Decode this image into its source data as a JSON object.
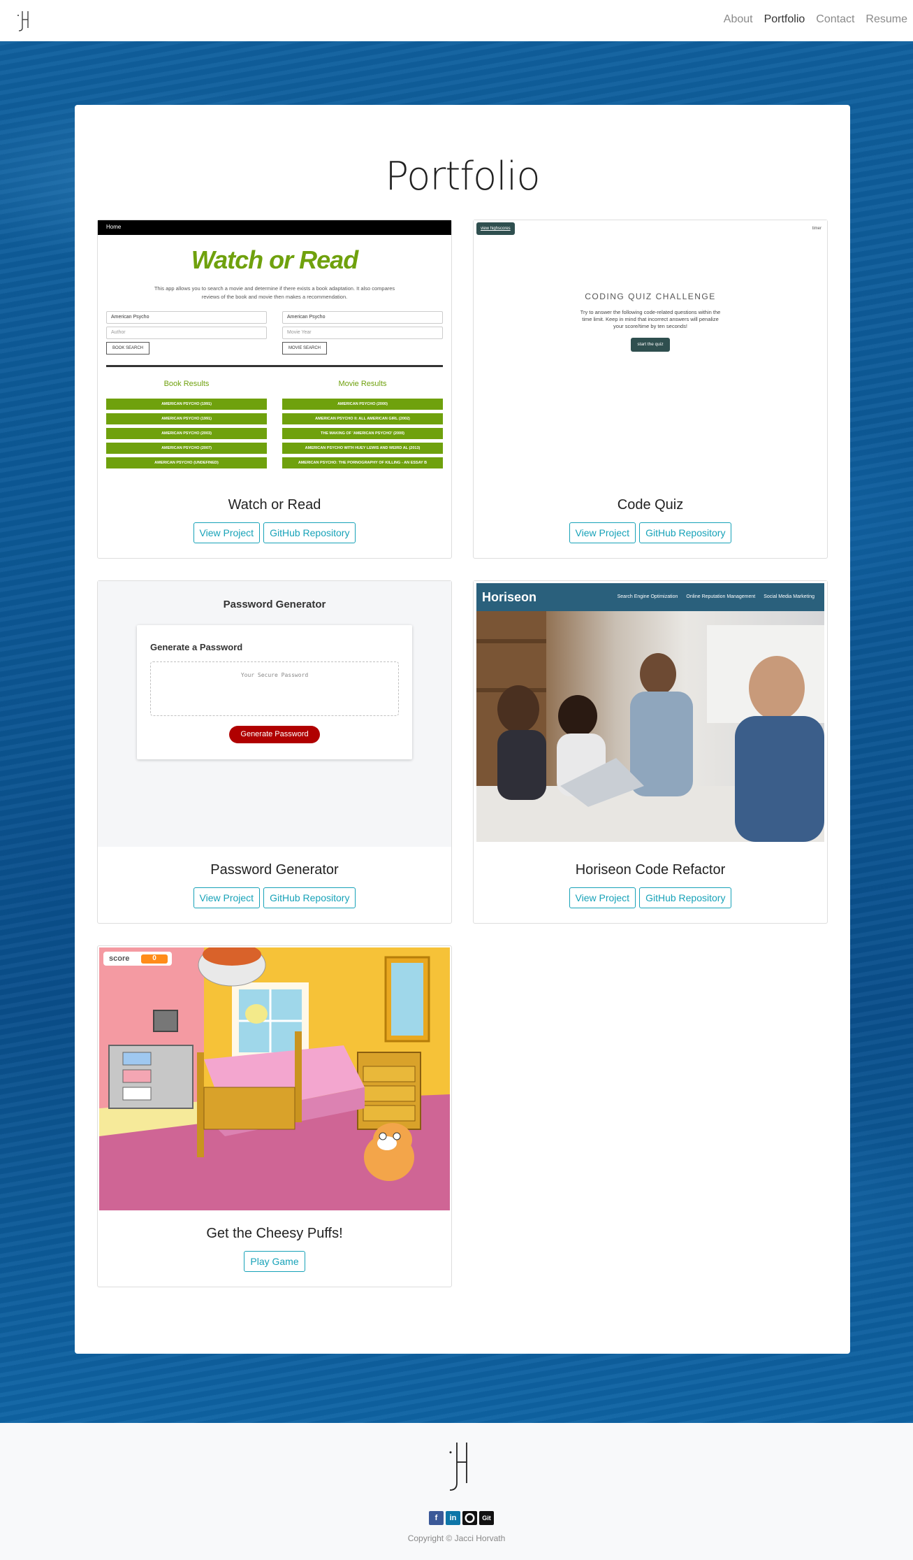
{
  "nav": {
    "brand": "jH",
    "links": [
      "About",
      "Portfolio",
      "Contact",
      "Resume"
    ],
    "active": "Portfolio"
  },
  "main": {
    "title": "Portfolio",
    "projects": [
      {
        "title": "Watch or Read",
        "buttons": [
          "View Project",
          "GitHub Repository"
        ],
        "preview": {
          "nav_label": "Home",
          "heading": "Watch or Read",
          "description": "This app allows you to search a movie and determine if there exists a book adaptation. It also compares reviews of the book and movie then makes a recommendation.",
          "book_title_value": "American Psycho",
          "author_placeholder": "Author",
          "book_search": "BOOK SEARCH",
          "movie_title_value": "American Psycho",
          "year_placeholder": "Movie Year",
          "movie_search": "MOVIE SEARCH",
          "book_results_heading": "Book Results",
          "movie_results_heading": "Movie Results",
          "book_results": [
            "AMERICAN PSYCHO (1991)",
            "AMERICAN PSYCHO (1991)",
            "AMERICAN PSYCHO (2003)",
            "AMERICAN PSYCHO (2007)",
            "AMERICAN PSYCHO (UNDEFINED)"
          ],
          "movie_results": [
            "AMERICAN PSYCHO (2000)",
            "AMERICAN PSYCHO II: ALL AMERICAN GIRL (2002)",
            "THE MAKING OF 'AMERICAN PSYCHO' (2000)",
            "AMERICAN PSYCHO WITH HUEY LEWIS AND WEIRD AL (2013)",
            "AMERICAN PSYCHO: THE PORNOGRAPHY OF KILLING - AN ESSAY B"
          ]
        }
      },
      {
        "title": "Code Quiz",
        "buttons": [
          "View Project",
          "GitHub Repository"
        ],
        "preview": {
          "highscores": "view highscores",
          "timer": "timer",
          "heading": "CODING QUIZ CHALLENGE",
          "description": "Try to answer the following code-related questions within the time limit. Keep in mind that incorrect answers will penalize your score/time by ten seconds!",
          "start": "start the quiz"
        }
      },
      {
        "title": "Password Generator",
        "buttons": [
          "View Project",
          "GitHub Repository"
        ],
        "preview": {
          "page_title": "Password Generator",
          "card_heading": "Generate a Password",
          "placeholder": "Your Secure Password",
          "button": "Generate Password"
        }
      },
      {
        "title": "Horiseon Code Refactor",
        "buttons": [
          "View Project",
          "GitHub Repository"
        ],
        "preview": {
          "logo": "Horiseon",
          "nav": [
            "Search Engine Optimization",
            "Online Reputation Management",
            "Social Media Marketing"
          ]
        }
      },
      {
        "title": "Get the Cheesy Puffs!",
        "buttons": [
          "Play Game"
        ],
        "preview": {
          "score_label": "score",
          "score_value": "0"
        }
      }
    ]
  },
  "footer": {
    "social": [
      "facebook-icon",
      "linkedin-icon",
      "github-icon",
      "git-icon"
    ],
    "git_label": "Git",
    "copyright": "Copyright © Jacci Horvath"
  },
  "colors": {
    "accent": "#17a2b8",
    "brand_green": "#6fa10d",
    "quiz_dark": "#2f4f4f",
    "pw_red": "#b00000",
    "horiseon_blue": "#2a607c"
  }
}
